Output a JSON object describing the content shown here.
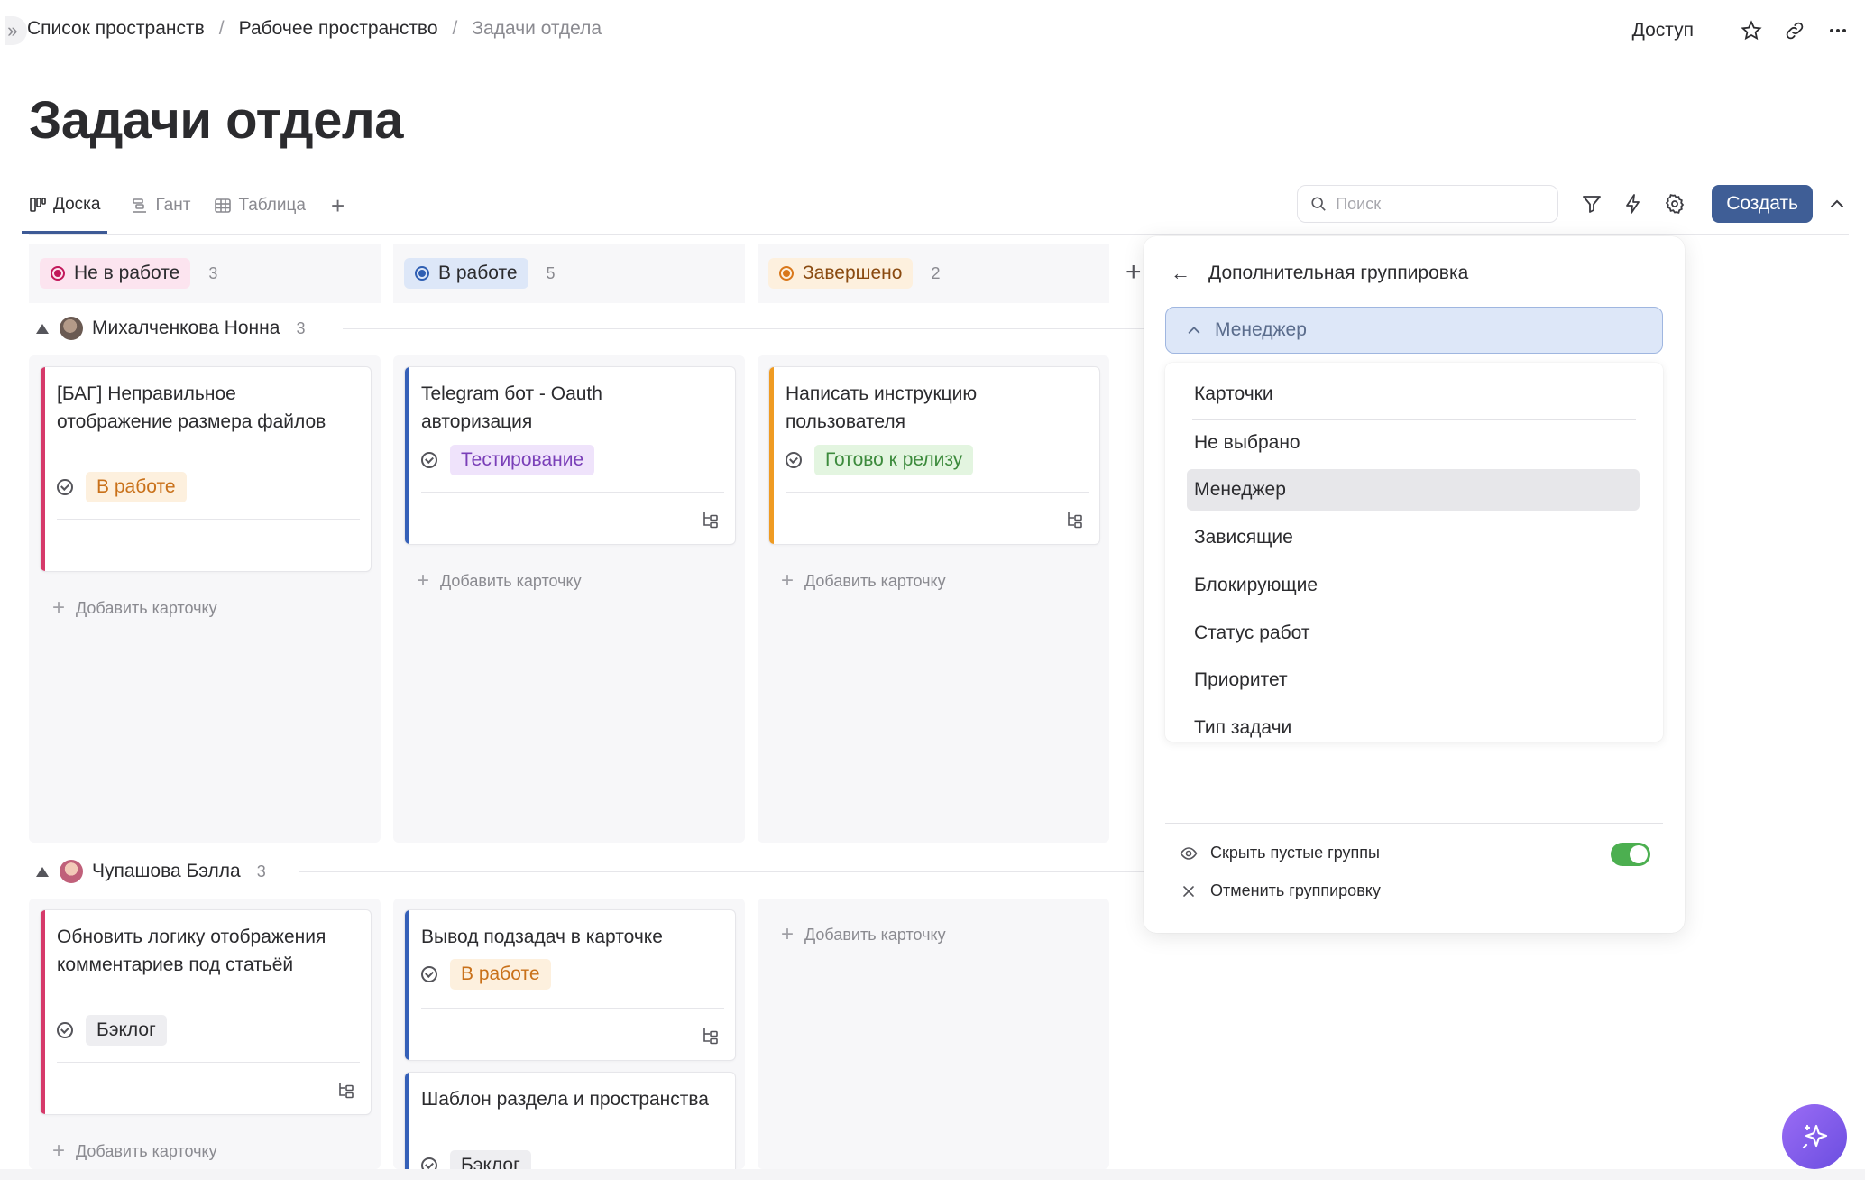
{
  "breadcrumb": {
    "items": [
      "Список пространств",
      "Рабочее пространство"
    ],
    "current": "Задачи отдела",
    "sep": "/"
  },
  "top": {
    "access_label": "Доступ"
  },
  "page": {
    "title": "Задачи отдела"
  },
  "tabs": [
    {
      "label": "Доска",
      "icon": "board-icon",
      "active": true
    },
    {
      "label": "Гант",
      "icon": "gantt-icon"
    },
    {
      "label": "Таблица",
      "icon": "table-icon"
    }
  ],
  "toolbar": {
    "search_placeholder": "Поиск",
    "create_label": "Создать"
  },
  "columns": [
    {
      "label": "Не в работе",
      "count": "3",
      "color": "#c2185b",
      "bg": "#fce4ef"
    },
    {
      "label": "В работе",
      "count": "5",
      "color": "#2f5fb3",
      "bg": "#dde7f8"
    },
    {
      "label": "Завершено",
      "count": "2",
      "color": "#d9771a",
      "bg": "#fdf0de"
    }
  ],
  "groups": [
    {
      "name": "Михалченкова Нонна",
      "count": "3",
      "cards": [
        {
          "title": "[БАГ] Неправильное отображение размера файлов",
          "tag": "В работе",
          "tag_color": "#c9711a",
          "tag_bg": "#fdf0de",
          "accent": "#d63a6a"
        },
        {
          "title": "Telegram бот - Oauth авторизация",
          "tag": "Тестирование",
          "tag_color": "#7a3fb8",
          "tag_bg": "#efe3fb",
          "accent": "#3560b8"
        },
        {
          "title": "Написать инструкцию пользователя",
          "tag": "Готово к релизу",
          "tag_color": "#3c8a3c",
          "tag_bg": "#e3f5e0",
          "accent": "#ef9b22"
        }
      ]
    },
    {
      "name": "Чупашова Бэлла",
      "count": "3",
      "cards": [
        {
          "title": "Обновить логику отображения комментариев под статьёй",
          "tag": "Бэклог",
          "tag_color": "#2b2b2e",
          "tag_bg": "#eeeef1",
          "accent": "#d63a6a"
        },
        {
          "title": "Вывод подзадач в карточке",
          "tag": "В работе",
          "tag_color": "#c9711a",
          "tag_bg": "#fdf0de",
          "accent": "#3560b8"
        },
        {
          "title": "Шаблон раздела и пространства",
          "tag": "Бэклог",
          "tag_color": "#2b2b2e",
          "tag_bg": "#eeeef1",
          "accent": "#3560b8"
        }
      ]
    }
  ],
  "add_card_label": "Добавить карточку",
  "panel": {
    "title": "Дополнительная группировка",
    "selected_value": "Менеджер",
    "options": [
      "Карточки",
      "Не выбрано",
      "Менеджер",
      "Зависящие",
      "Блокирующие",
      "Статус работ",
      "Приоритет",
      "Тип задачи"
    ],
    "hide_empty_label": "Скрыть пустые группы",
    "hide_empty_on": true,
    "cancel_label": "Отменить группировку"
  },
  "colors": {
    "accent": "#3f5e96",
    "toggle_on": "#4caf50"
  }
}
